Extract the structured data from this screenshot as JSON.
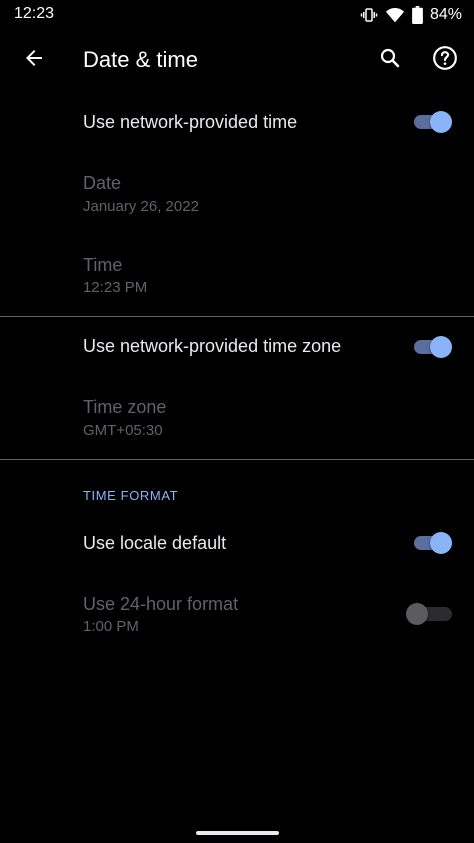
{
  "status_bar": {
    "time": "12:23",
    "battery_percent": "84%",
    "icons": [
      "vibrate-icon",
      "wifi-icon",
      "battery-icon"
    ]
  },
  "toolbar": {
    "title": "Date & time",
    "back_icon": "arrow-back-icon",
    "search_icon": "search-icon",
    "help_icon": "help-icon"
  },
  "settings": {
    "network_time": {
      "title": "Use network-provided time",
      "enabled": true
    },
    "date": {
      "title": "Date",
      "summary": "January 26, 2022"
    },
    "time": {
      "title": "Time",
      "summary": "12:23 PM"
    },
    "network_time_zone": {
      "title": "Use network-provided time zone",
      "enabled": true
    },
    "time_zone": {
      "title": "Time zone",
      "summary": "GMT+05:30"
    }
  },
  "time_format": {
    "header": "TIME FORMAT",
    "locale_default": {
      "title": "Use locale default",
      "enabled": true
    },
    "twenty_four_hour": {
      "title": "Use 24-hour format",
      "summary": "1:00 PM",
      "enabled": false
    }
  },
  "colors": {
    "accent": "#8ab4f8",
    "background": "#000000",
    "disabled_text": "#5f6368"
  }
}
